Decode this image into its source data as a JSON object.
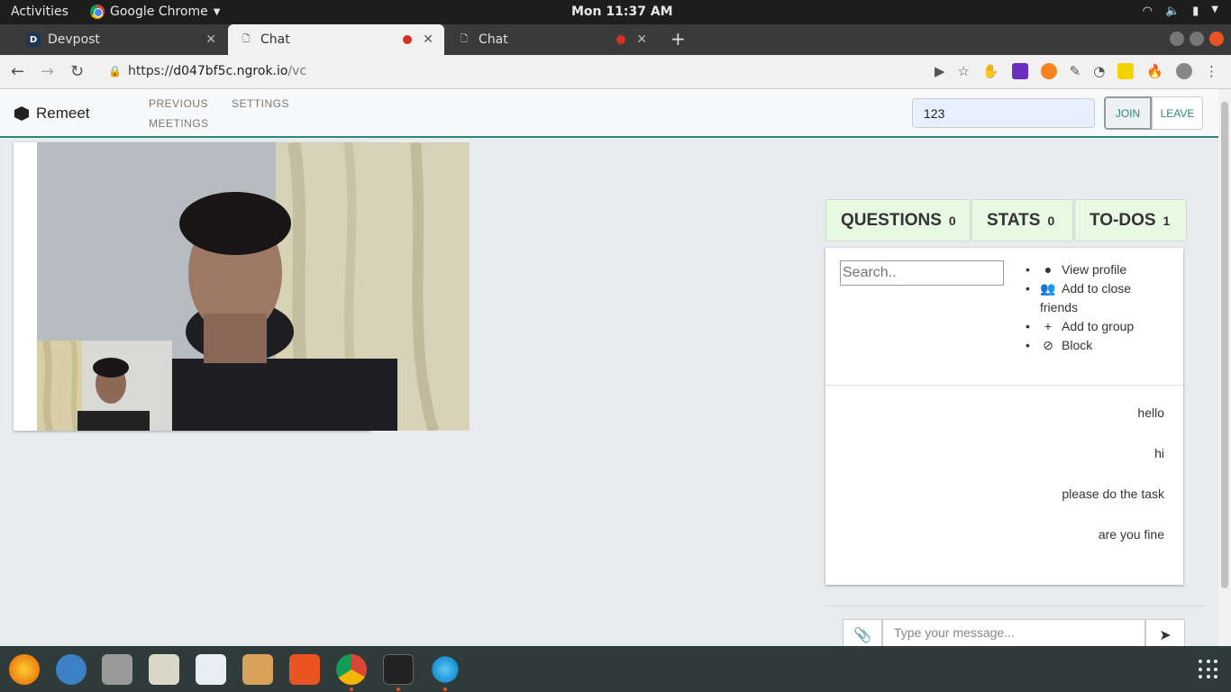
{
  "os_topbar": {
    "activities": "Activities",
    "app_name": "Google Chrome",
    "clock": "Mon 11:37 AM"
  },
  "browser": {
    "tabs": [
      {
        "title": "Devpost",
        "favicon": "D"
      },
      {
        "title": "Chat",
        "recording": true
      },
      {
        "title": "Chat",
        "recording": true
      }
    ],
    "url": {
      "scheme": "https://",
      "host": "d047bf5c.ngrok.io",
      "path": "/vc"
    }
  },
  "app": {
    "brand": "Remeet",
    "nav": {
      "previous_1": "PREVIOUS",
      "previous_2": "MEETINGS",
      "settings": "SETTINGS"
    },
    "room_input_value": "123",
    "join_label": "JOIN",
    "leave_label": "LEAVE",
    "panel_tabs": [
      {
        "label": "QUESTIONS",
        "count": "0"
      },
      {
        "label": "STATS",
        "count": "0"
      },
      {
        "label": "TO-DOS",
        "count": "1"
      }
    ],
    "search_placeholder": "Search..",
    "menu": {
      "view_profile": "View profile",
      "add_close_1": "Add to close",
      "add_close_2": "friends",
      "add_group": "Add to group",
      "block": "Block"
    },
    "messages": [
      "hello",
      "hi",
      "please do the task",
      "are you fine"
    ],
    "message_placeholder": "Type your message..."
  },
  "colors": {
    "accent": "#2a8a7a",
    "tab_bg": "#e8f9e3",
    "app_bg": "#e8ecef"
  }
}
